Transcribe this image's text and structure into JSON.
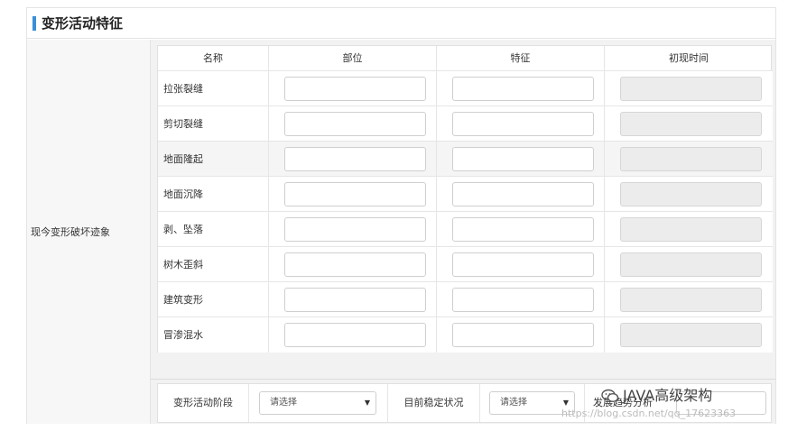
{
  "panel": {
    "title": "变形活动特征"
  },
  "row_label": "现今变形破坏迹象",
  "table": {
    "headers": [
      "名称",
      "部位",
      "特征",
      "初现时间"
    ],
    "rows": [
      {
        "name": "拉张裂缝"
      },
      {
        "name": "剪切裂缝"
      },
      {
        "name": "地面隆起"
      },
      {
        "name": "地面沉降"
      },
      {
        "name": "剥、坠落"
      },
      {
        "name": "树木歪斜"
      },
      {
        "name": "建筑变形"
      },
      {
        "name": "冒渗混水"
      }
    ]
  },
  "bottom": {
    "stage_label": "变形活动阶段",
    "stage_select": "请选择",
    "stability_label": "目前稳定状况",
    "stability_select": "请选择",
    "trend_label": "发展趋势分析"
  },
  "watermark": {
    "text": "JAVA高级架构",
    "url": "https://blog.csdn.net/qq_17623363"
  },
  "colors": {
    "accent": "#3a8fd8",
    "disabled_input": "#ececec"
  },
  "icons": {
    "caret": "caret-down-icon",
    "watermark": "wechat-icon"
  }
}
